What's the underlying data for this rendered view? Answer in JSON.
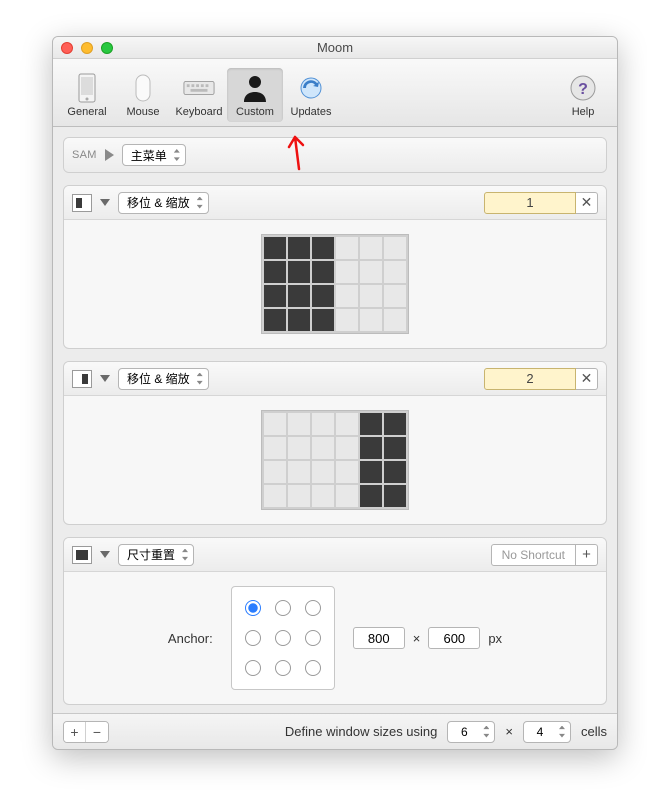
{
  "window": {
    "title": "Moom"
  },
  "toolbar": {
    "general": "General",
    "mouse": "Mouse",
    "keyboard": "Keyboard",
    "custom": "Custom",
    "updates": "Updates",
    "help": "Help",
    "selected": "custom"
  },
  "panels": {
    "header": {
      "tag": "SAM",
      "menu": "主菜单"
    },
    "item1": {
      "action": "移位 & 缩放",
      "shortcut": "1",
      "grid": {
        "cols": 6,
        "rows": 4,
        "selected_cols": [
          0,
          1,
          2
        ]
      }
    },
    "item2": {
      "action": "移位 & 缩放",
      "shortcut": "2",
      "grid": {
        "cols": 6,
        "rows": 4,
        "selected_cols": [
          4,
          5
        ]
      }
    },
    "item3": {
      "action": "尺寸重置",
      "noshortcut": "No Shortcut",
      "anchor_label": "Anchor:",
      "anchor_selected": 0,
      "width": "800",
      "height": "600",
      "sep": "×",
      "unit": "px"
    }
  },
  "footer": {
    "define_label": "Define window sizes using",
    "cols": "6",
    "rows": "4",
    "sep": "×",
    "cells_label": "cells"
  }
}
